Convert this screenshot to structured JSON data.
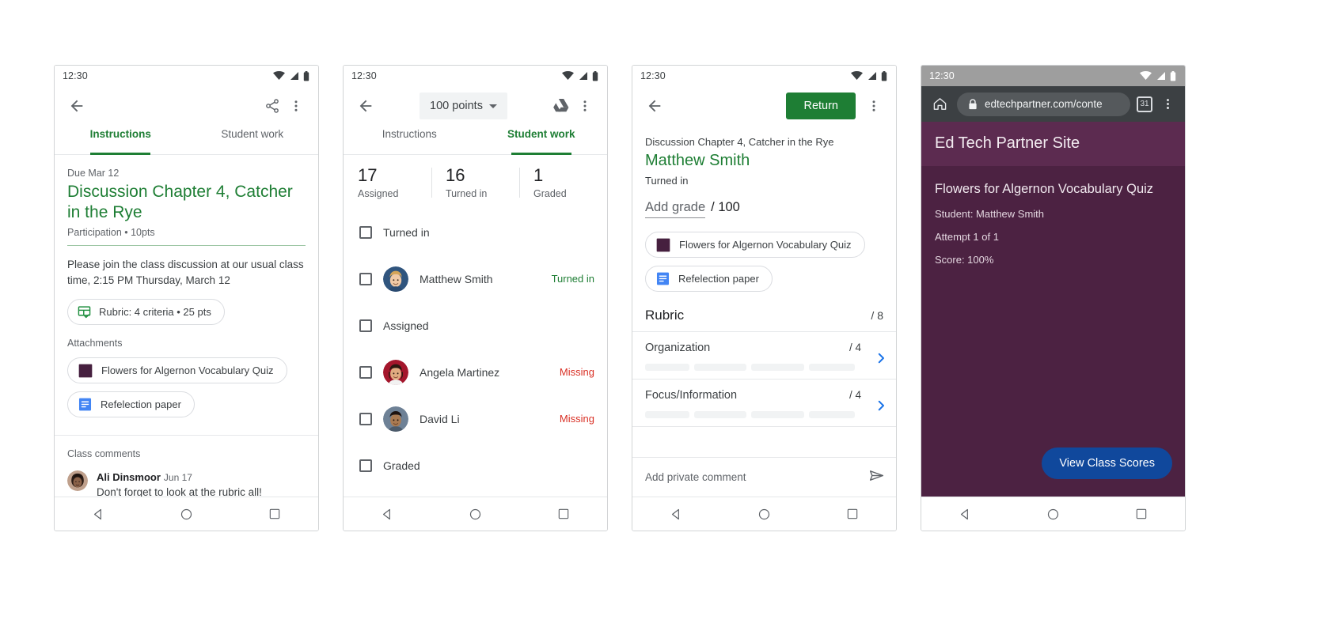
{
  "status_bar": {
    "time": "12:30"
  },
  "nav_bar": {
    "back": "back-triangle",
    "home": "home-circle",
    "recents": "recents-square"
  },
  "phone1": {
    "appbar": {
      "back_icon": "back-arrow",
      "share_icon": "share",
      "more_icon": "more-vert"
    },
    "tabs": [
      {
        "label": "Instructions",
        "active": true
      },
      {
        "label": "Student work",
        "active": false
      }
    ],
    "assignment": {
      "due": "Due Mar 12",
      "title": "Discussion Chapter 4, Catcher in the Rye",
      "meta": "Participation • 10pts",
      "description": "Please join the class discussion at our usual class time, 2:15 PM Thursday, March 12",
      "rubric_chip": "Rubric: 4 criteria • 25 pts",
      "attachments_label": "Attachments",
      "attachments": [
        {
          "name": "Flowers for Algernon Vocabulary Quiz",
          "icon": "form-thumbnail",
          "color": "#46203f"
        },
        {
          "name": "Refelection paper",
          "icon": "google-docs",
          "color": "#4285f4"
        }
      ]
    },
    "comments": {
      "heading": "Class comments",
      "items": [
        {
          "author": "Ali Dinsmoor",
          "date": "Jun 17",
          "text": "Don't forget to look at the rubric all!"
        }
      ]
    }
  },
  "phone2": {
    "appbar": {
      "back_icon": "back-arrow",
      "points": "100 points",
      "drive_icon": "google-drive",
      "more_icon": "more-vert"
    },
    "tabs": [
      {
        "label": "Instructions",
        "active": false
      },
      {
        "label": "Student work",
        "active": true
      }
    ],
    "stats": [
      {
        "num": "17",
        "caption": "Assigned"
      },
      {
        "num": "16",
        "caption": "Turned in"
      },
      {
        "num": "1",
        "caption": "Graded"
      }
    ],
    "rows": [
      {
        "type": "group",
        "label": "Turned in"
      },
      {
        "type": "student",
        "label": "Matthew Smith",
        "status": "Turned in",
        "status_kind": "turned",
        "avatar": "boy-blond"
      },
      {
        "type": "group",
        "label": "Assigned"
      },
      {
        "type": "student",
        "label": "Angela Martinez",
        "status": "Missing",
        "status_kind": "missing",
        "avatar": "girl-red"
      },
      {
        "type": "student",
        "label": "David Li",
        "status": "Missing",
        "status_kind": "missing",
        "avatar": "boy-dark"
      },
      {
        "type": "group",
        "label": "Graded"
      }
    ]
  },
  "phone3": {
    "appbar": {
      "back_icon": "back-arrow",
      "return_label": "Return",
      "more_icon": "more-vert"
    },
    "assignment_title": "Discussion Chapter 4, Catcher in the Rye",
    "student_name": "Matthew Smith",
    "state": "Turned in",
    "grade": {
      "add_label": "Add grade",
      "out_of": "/ 100"
    },
    "attachments": [
      {
        "name": "Flowers for Algernon Vocabulary Quiz",
        "icon": "form-thumbnail",
        "color": "#46203f"
      },
      {
        "name": "Refelection paper",
        "icon": "google-docs",
        "color": "#4285f4"
      }
    ],
    "rubric": {
      "title": "Rubric",
      "total": "/ 8",
      "criteria": [
        {
          "name": "Organization",
          "score": "/ 4"
        },
        {
          "name": "Focus/Information",
          "score": "/ 4"
        }
      ]
    },
    "comment_bar": {
      "placeholder": "Add private comment",
      "send_icon": "send"
    }
  },
  "phone4": {
    "browser": {
      "home_icon": "home",
      "lock_icon": "lock",
      "url": "edtechpartner.com/conte",
      "tab_count": "31",
      "more_icon": "more-vert"
    },
    "site": {
      "header_title": "Ed Tech Partner Site",
      "page_title": "Flowers for Algernon Vocabulary Quiz",
      "lines": [
        "Student: Matthew Smith",
        "Attempt 1 of 1",
        "Score: 100%"
      ],
      "cta": "View Class Scores",
      "bg": "#4c2242",
      "header_bg": "#5c2b50",
      "cta_bg": "#10489c"
    }
  },
  "colors": {
    "green": "#1e7e34",
    "red": "#d93025",
    "blue": "#1a73e8",
    "grey_text": "#5f6368"
  }
}
